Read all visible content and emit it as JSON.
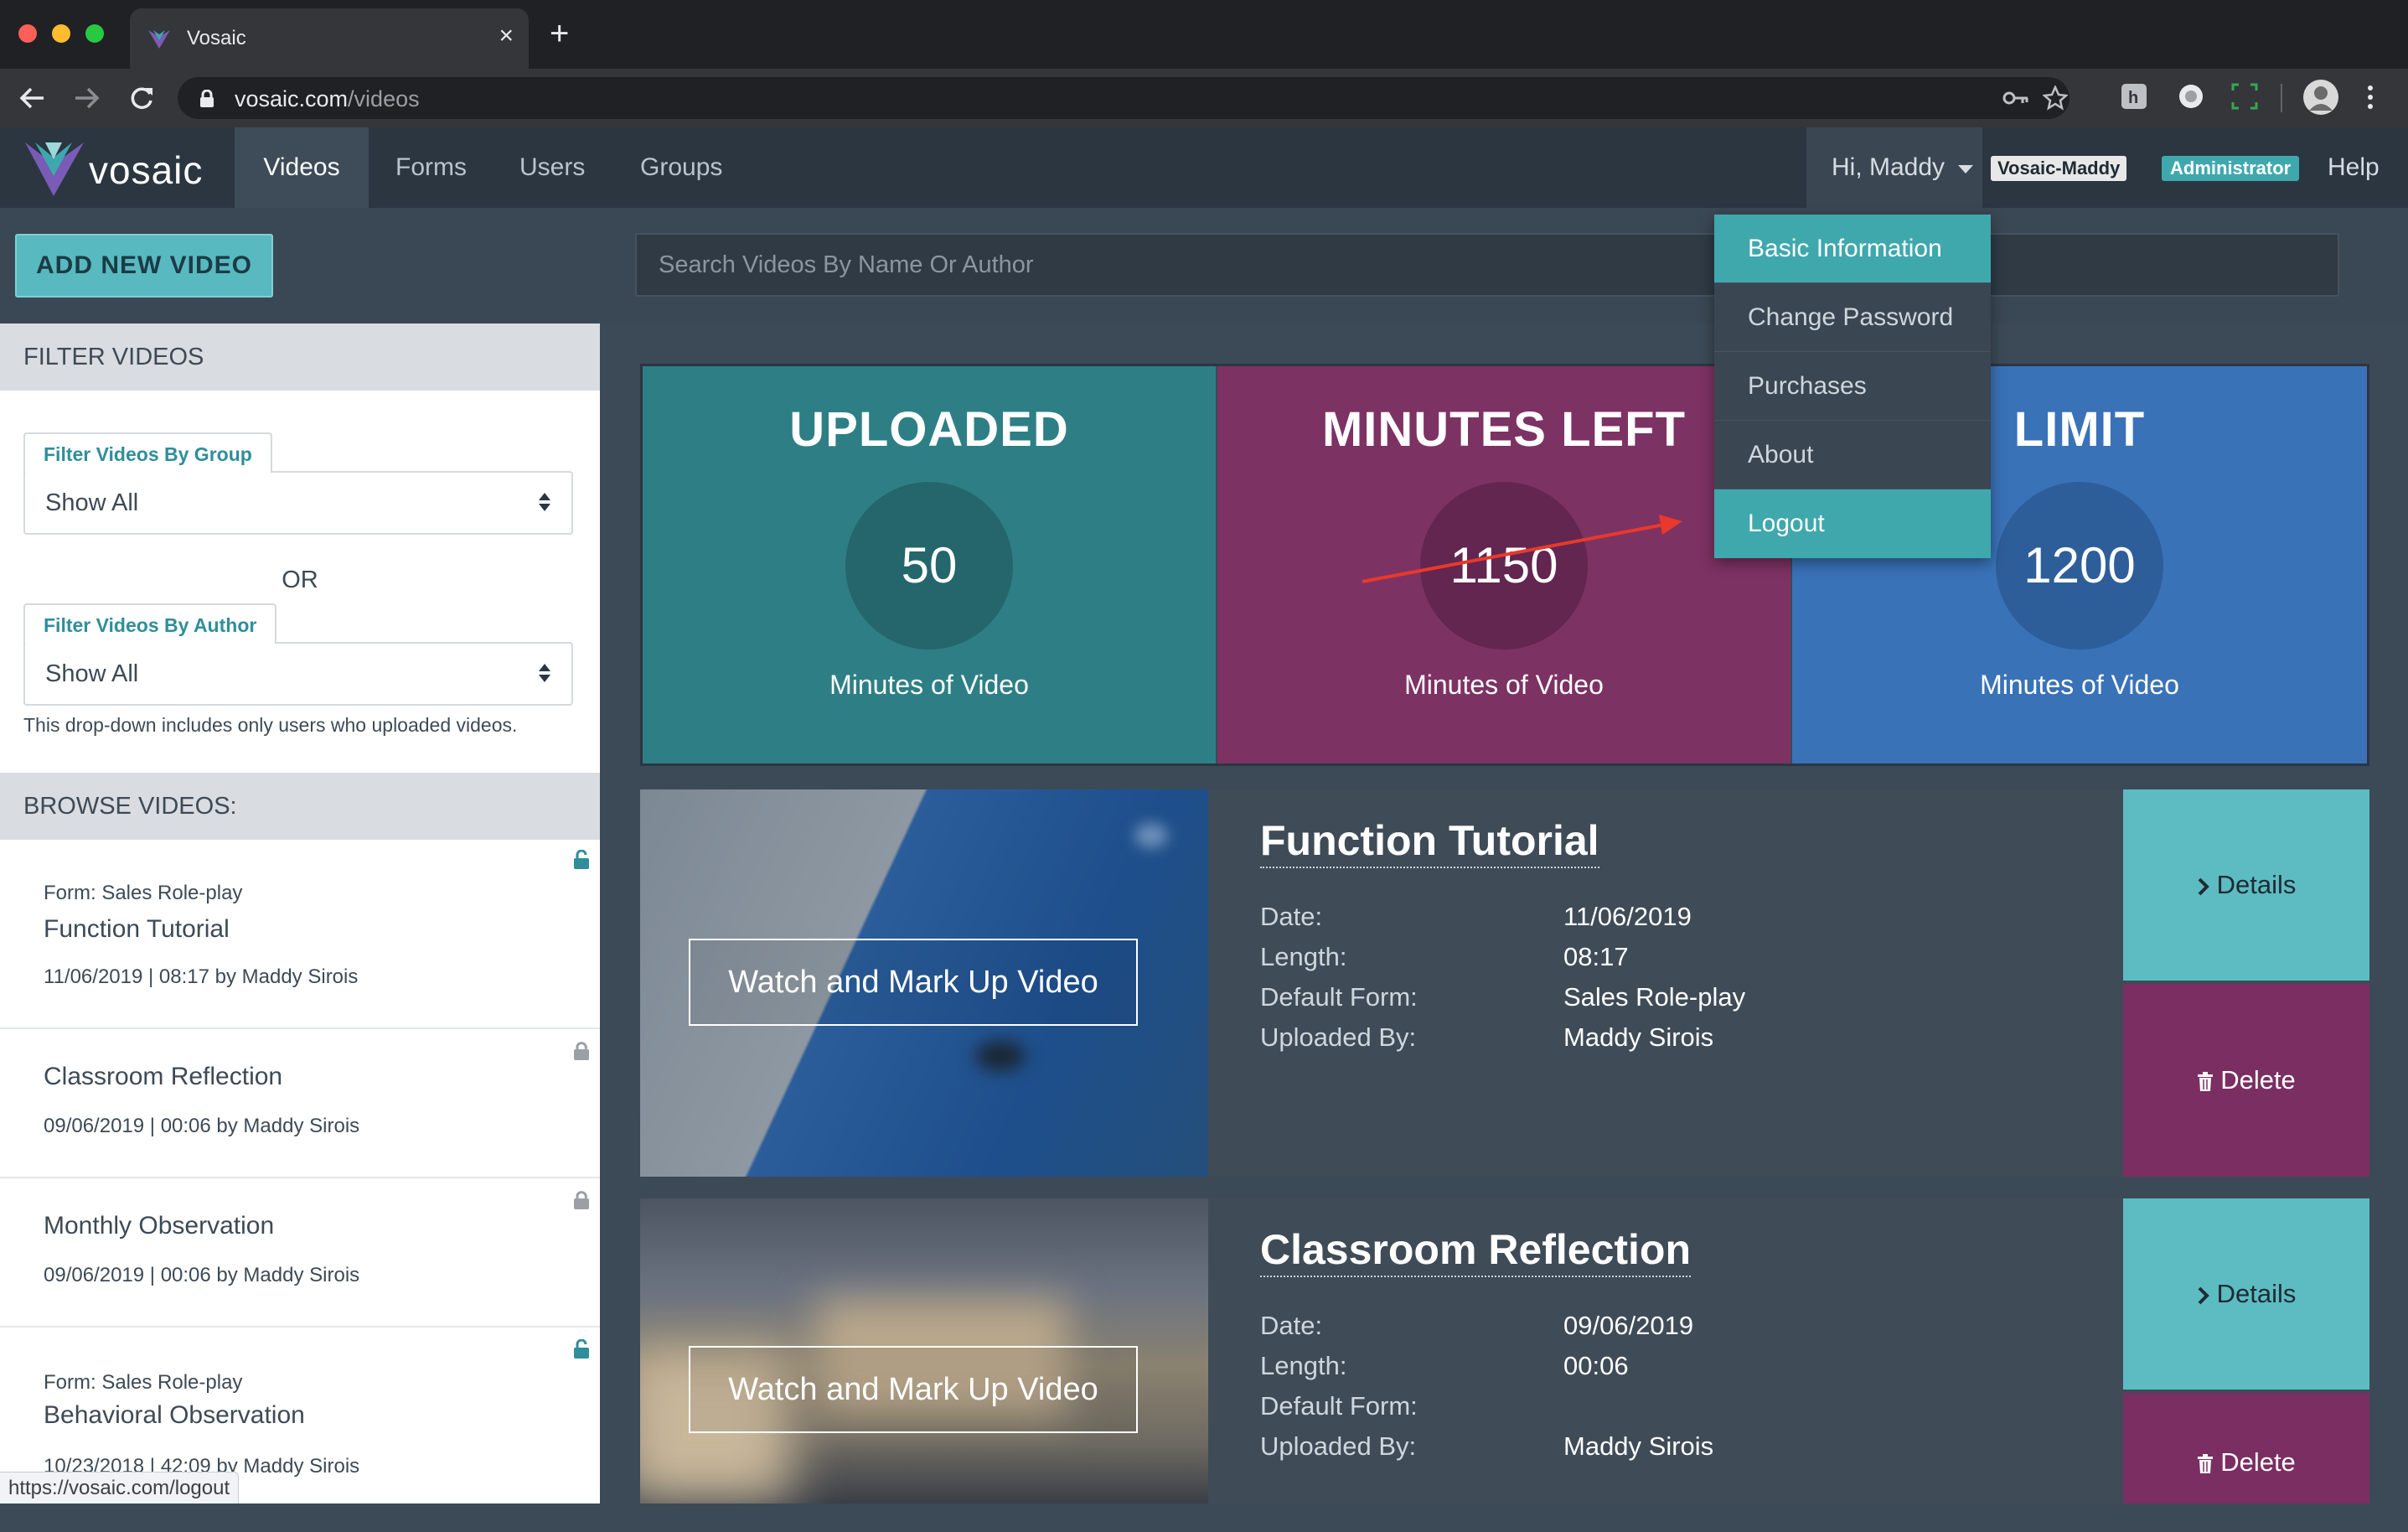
{
  "browser": {
    "tab_title": "Vosaic",
    "url_domain": "vosaic.com",
    "url_path": "/videos",
    "status_url": "https://vosaic.com/logout"
  },
  "nav": {
    "logo_text": "vosaic",
    "items": [
      "Videos",
      "Forms",
      "Users",
      "Groups"
    ],
    "active": "Videos",
    "greeting": "Hi, Maddy",
    "account_badge": "Vosaic-Maddy",
    "role_badge": "Administrator",
    "help": "Help"
  },
  "user_dropdown": {
    "items": [
      "Basic Information",
      "Change Password",
      "Purchases",
      "About",
      "Logout"
    ],
    "highlighted": [
      "Basic Information",
      "Logout"
    ]
  },
  "actions": {
    "add_video": "ADD NEW VIDEO",
    "search_placeholder": "Search Videos By Name Or Author"
  },
  "sidebar": {
    "filter_heading": "FILTER VIDEOS",
    "group_filter": {
      "label": "Filter Videos By Group",
      "value": "Show All"
    },
    "or": "OR",
    "author_filter": {
      "label": "Filter Videos By Author",
      "value": "Show All"
    },
    "author_note": "This drop-down includes only users who uploaded videos.",
    "browse_heading": "BROWSE VIDEOS:",
    "videos": [
      {
        "form": "Form: Sales Role-play",
        "title": "Function Tutorial",
        "meta": "11/06/2019 | 08:17 by Maddy Sirois",
        "locked_style": "teal"
      },
      {
        "form": "",
        "title": "Classroom Reflection",
        "meta": "09/06/2019 | 00:06 by Maddy Sirois",
        "locked_style": "gray"
      },
      {
        "form": "",
        "title": "Monthly Observation",
        "meta": "09/06/2019 | 00:06 by Maddy Sirois",
        "locked_style": "gray"
      },
      {
        "form": "Form: Sales Role-play",
        "title": "Behavioral Observation",
        "meta": "10/23/2018 | 42:09 by Maddy Sirois",
        "locked_style": "teal"
      }
    ]
  },
  "stats": [
    {
      "label": "UPLOADED",
      "value": "50",
      "unit": "Minutes of Video",
      "color": "#2e7f85"
    },
    {
      "label": "MINUTES LEFT",
      "value": "1150",
      "unit": "Minutes of Video",
      "color": "#7d3264"
    },
    {
      "label": "LIMIT",
      "value": "1200",
      "unit": "Minutes of Video",
      "color": "#3a72b8"
    }
  ],
  "cards": [
    {
      "title": "Function Tutorial",
      "watch": "Watch and Mark Up Video",
      "fields": [
        {
          "label": "Date:",
          "value": "11/06/2019"
        },
        {
          "label": "Length:",
          "value": "08:17"
        },
        {
          "label": "Default Form:",
          "value": "Sales Role-play"
        },
        {
          "label": "Uploaded By:",
          "value": "Maddy Sirois"
        }
      ],
      "details": "Details",
      "delete": "Delete"
    },
    {
      "title": "Classroom Reflection",
      "watch": "Watch and Mark Up Video",
      "fields": [
        {
          "label": "Date:",
          "value": "09/06/2019"
        },
        {
          "label": "Length:",
          "value": "00:06"
        },
        {
          "label": "Default Form:",
          "value": ""
        },
        {
          "label": "Uploaded By:",
          "value": "Maddy Sirois"
        }
      ],
      "details": "Details",
      "delete": "Delete"
    }
  ],
  "colors": {
    "accent_teal": "#58b9c0",
    "nav_bg": "#2b3641",
    "purple": "#7b2e62",
    "annotation_arrow": "#e8392b"
  }
}
